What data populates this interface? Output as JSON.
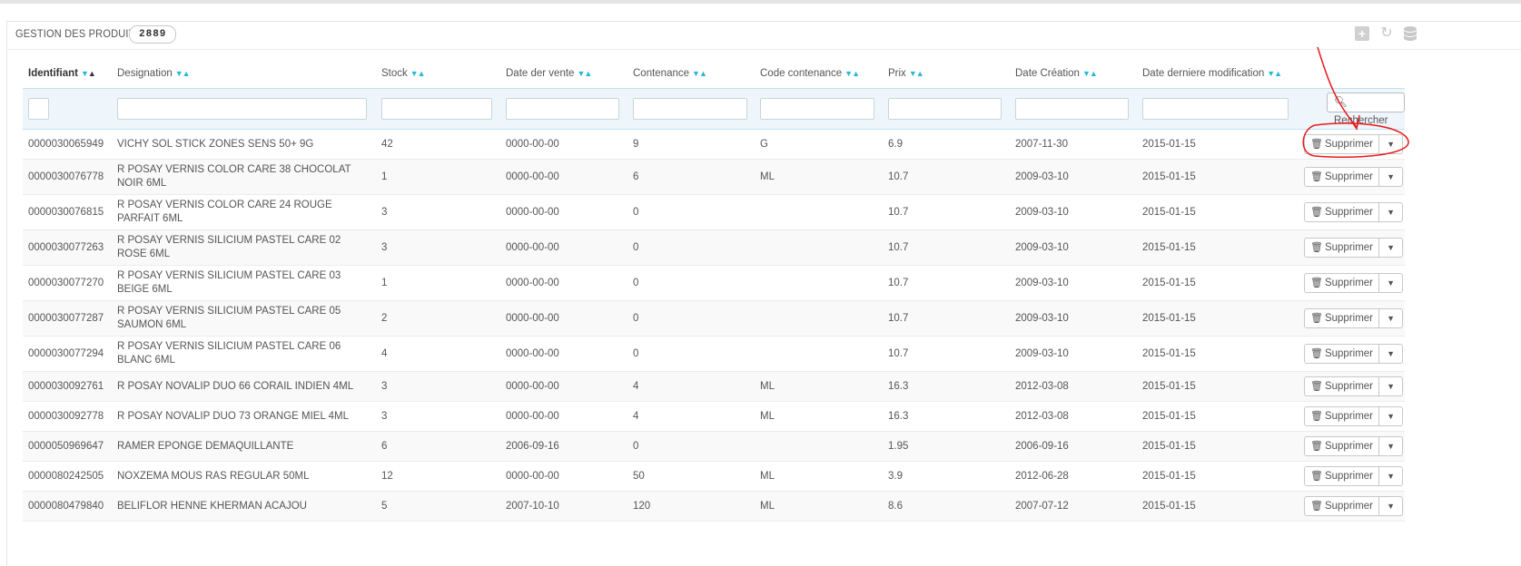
{
  "panel": {
    "title": "GESTION DES PRODUITS",
    "count": "2889"
  },
  "toolbar_icons": [
    "add-icon",
    "refresh-icon",
    "database-icon"
  ],
  "columns": [
    {
      "key": "id",
      "label": "Identifiant"
    },
    {
      "key": "designation",
      "label": "Designation"
    },
    {
      "key": "stock",
      "label": "Stock"
    },
    {
      "key": "date_vente",
      "label": "Date der vente"
    },
    {
      "key": "contenance",
      "label": "Contenance"
    },
    {
      "key": "code_contenance",
      "label": "Code contenance"
    },
    {
      "key": "prix",
      "label": "Prix"
    },
    {
      "key": "date_creation",
      "label": "Date Création"
    },
    {
      "key": "date_modif",
      "label": "Date derniere modification"
    }
  ],
  "search_button_label": "Rechercher",
  "delete_button_label": "Supprimer",
  "rows": [
    {
      "id": "0000030065949",
      "designation": "VICHY SOL STICK ZONES SENS 50+ 9G",
      "stock": "42",
      "date_vente": "0000-00-00",
      "contenance": "9",
      "code_contenance": "G",
      "prix": "6.9",
      "date_creation": "2007-11-30",
      "date_modif": "2015-01-15"
    },
    {
      "id": "0000030076778",
      "designation": "R POSAY VERNIS COLOR CARE 38 CHOCOLAT NOIR 6ML",
      "stock": "1",
      "date_vente": "0000-00-00",
      "contenance": "6",
      "code_contenance": "ML",
      "prix": "10.7",
      "date_creation": "2009-03-10",
      "date_modif": "2015-01-15"
    },
    {
      "id": "0000030076815",
      "designation": "R POSAY VERNIS COLOR CARE 24 ROUGE PARFAIT 6ML",
      "stock": "3",
      "date_vente": "0000-00-00",
      "contenance": "0",
      "code_contenance": "",
      "prix": "10.7",
      "date_creation": "2009-03-10",
      "date_modif": "2015-01-15"
    },
    {
      "id": "0000030077263",
      "designation": "R POSAY VERNIS SILICIUM PASTEL CARE 02 ROSE 6ML",
      "stock": "3",
      "date_vente": "0000-00-00",
      "contenance": "0",
      "code_contenance": "",
      "prix": "10.7",
      "date_creation": "2009-03-10",
      "date_modif": "2015-01-15"
    },
    {
      "id": "0000030077270",
      "designation": "R POSAY VERNIS SILICIUM PASTEL CARE 03 BEIGE 6ML",
      "stock": "1",
      "date_vente": "0000-00-00",
      "contenance": "0",
      "code_contenance": "",
      "prix": "10.7",
      "date_creation": "2009-03-10",
      "date_modif": "2015-01-15"
    },
    {
      "id": "0000030077287",
      "designation": "R POSAY VERNIS SILICIUM PASTEL CARE 05 SAUMON 6ML",
      "stock": "2",
      "date_vente": "0000-00-00",
      "contenance": "0",
      "code_contenance": "",
      "prix": "10.7",
      "date_creation": "2009-03-10",
      "date_modif": "2015-01-15"
    },
    {
      "id": "0000030077294",
      "designation": "R POSAY VERNIS SILICIUM PASTEL CARE 06 BLANC 6ML",
      "stock": "4",
      "date_vente": "0000-00-00",
      "contenance": "0",
      "code_contenance": "",
      "prix": "10.7",
      "date_creation": "2009-03-10",
      "date_modif": "2015-01-15"
    },
    {
      "id": "0000030092761",
      "designation": "R POSAY NOVALIP DUO 66 CORAIL INDIEN 4ML",
      "stock": "3",
      "date_vente": "0000-00-00",
      "contenance": "4",
      "code_contenance": "ML",
      "prix": "16.3",
      "date_creation": "2012-03-08",
      "date_modif": "2015-01-15"
    },
    {
      "id": "0000030092778",
      "designation": "R POSAY NOVALIP DUO 73 ORANGE MIEL 4ML",
      "stock": "3",
      "date_vente": "0000-00-00",
      "contenance": "4",
      "code_contenance": "ML",
      "prix": "16.3",
      "date_creation": "2012-03-08",
      "date_modif": "2015-01-15"
    },
    {
      "id": "0000050969647",
      "designation": "RAMER EPONGE DEMAQUILLANTE",
      "stock": "6",
      "date_vente": "2006-09-16",
      "contenance": "0",
      "code_contenance": "",
      "prix": "1.95",
      "date_creation": "2006-09-16",
      "date_modif": "2015-01-15"
    },
    {
      "id": "0000080242505",
      "designation": "NOXZEMA MOUS RAS REGULAR 50ML",
      "stock": "12",
      "date_vente": "0000-00-00",
      "contenance": "50",
      "code_contenance": "ML",
      "prix": "3.9",
      "date_creation": "2012-06-28",
      "date_modif": "2015-01-15"
    },
    {
      "id": "0000080479840",
      "designation": "BELIFLOR HENNE KHERMAN ACAJOU",
      "stock": "5",
      "date_vente": "2007-10-10",
      "contenance": "120",
      "code_contenance": "ML",
      "prix": "8.6",
      "date_creation": "2007-07-12",
      "date_modif": "2015-01-15"
    }
  ],
  "colors": {
    "accent": "#25b9d7",
    "annotation": "#e8191c"
  }
}
